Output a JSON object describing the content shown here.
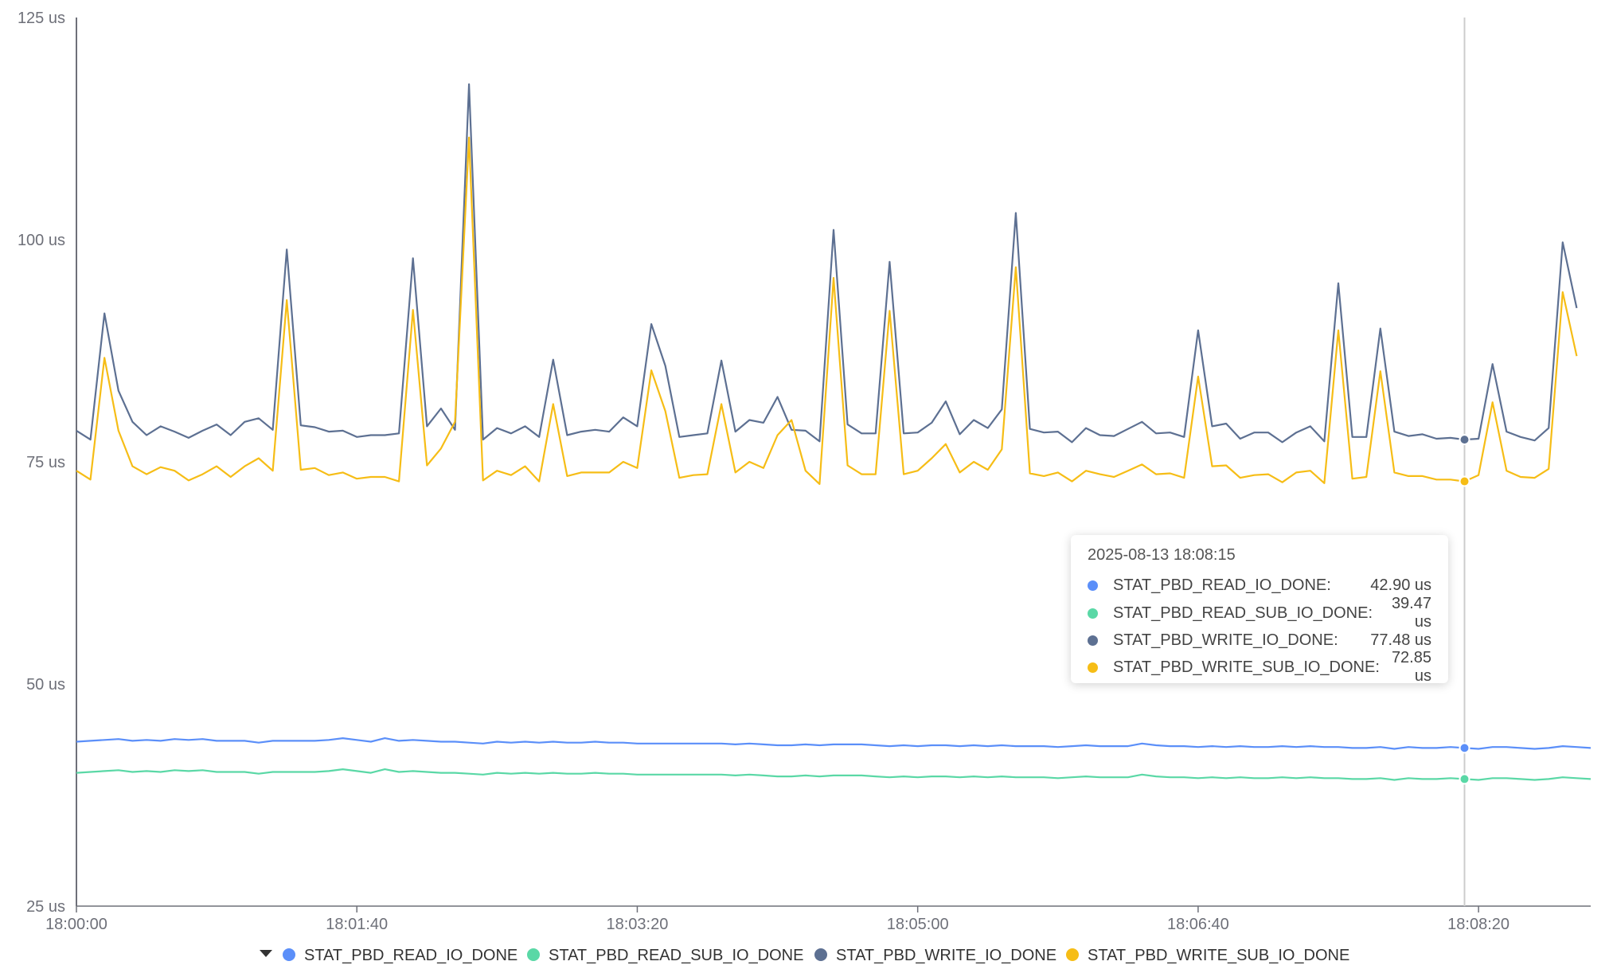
{
  "chart_data": {
    "type": "line",
    "y_unit": "us",
    "ylim": [
      25,
      125
    ],
    "y_ticks": [
      "25 us",
      "50 us",
      "75 us",
      "100 us",
      "125 us"
    ],
    "x_start": "18:00:00",
    "x_end": "18:09:00",
    "x_tick_labels": [
      "18:00:00",
      "18:01:40",
      "18:03:20",
      "18:05:00",
      "18:06:40",
      "18:08:20"
    ],
    "x_tick_seconds": [
      0,
      100,
      200,
      300,
      400,
      500
    ],
    "sample_interval_seconds": 5,
    "grid": false,
    "legend_position": "bottom",
    "series": [
      {
        "name": "STAT_PBD_READ_IO_DONE",
        "color": "#5b8ff9",
        "values": [
          43.5,
          43.6,
          43.7,
          43.8,
          43.6,
          43.7,
          43.6,
          43.8,
          43.7,
          43.8,
          43.6,
          43.6,
          43.6,
          43.4,
          43.6,
          43.6,
          43.6,
          43.6,
          43.7,
          43.9,
          43.7,
          43.5,
          43.9,
          43.6,
          43.7,
          43.6,
          43.5,
          43.5,
          43.4,
          43.3,
          43.5,
          43.4,
          43.5,
          43.4,
          43.5,
          43.4,
          43.4,
          43.5,
          43.4,
          43.4,
          43.3,
          43.3,
          43.3,
          43.3,
          43.3,
          43.3,
          43.3,
          43.2,
          43.3,
          43.2,
          43.1,
          43.1,
          43.2,
          43.1,
          43.2,
          43.2,
          43.2,
          43.1,
          43.0,
          43.1,
          43.0,
          43.1,
          43.1,
          43.0,
          43.1,
          43.0,
          43.1,
          43.0,
          43.0,
          43.0,
          42.9,
          43.0,
          43.1,
          43.0,
          43.0,
          43.0,
          43.3,
          43.1,
          43.0,
          43.0,
          42.9,
          43.0,
          42.9,
          43.0,
          42.9,
          42.9,
          43.0,
          42.9,
          43.0,
          42.9,
          42.9,
          42.8,
          42.8,
          42.9,
          42.7,
          42.9,
          42.8,
          42.8,
          42.9,
          42.8,
          42.7,
          42.9,
          42.9,
          42.8,
          42.7,
          42.8,
          43.0,
          42.9,
          42.8
        ]
      },
      {
        "name": "STAT_PBD_READ_SUB_IO_DONE",
        "color": "#5ad8a6",
        "values": [
          40.0,
          40.1,
          40.2,
          40.3,
          40.1,
          40.2,
          40.1,
          40.3,
          40.2,
          40.3,
          40.1,
          40.1,
          40.1,
          39.9,
          40.1,
          40.1,
          40.1,
          40.1,
          40.2,
          40.4,
          40.2,
          40.0,
          40.4,
          40.1,
          40.2,
          40.1,
          40.0,
          40.0,
          39.9,
          39.8,
          40.0,
          39.9,
          40.0,
          39.9,
          40.0,
          39.9,
          39.9,
          40.0,
          39.9,
          39.9,
          39.8,
          39.8,
          39.8,
          39.8,
          39.8,
          39.8,
          39.8,
          39.7,
          39.8,
          39.7,
          39.6,
          39.6,
          39.7,
          39.6,
          39.7,
          39.7,
          39.7,
          39.6,
          39.5,
          39.6,
          39.5,
          39.6,
          39.6,
          39.5,
          39.6,
          39.5,
          39.6,
          39.5,
          39.5,
          39.5,
          39.4,
          39.5,
          39.6,
          39.5,
          39.5,
          39.5,
          39.8,
          39.6,
          39.5,
          39.5,
          39.4,
          39.5,
          39.4,
          39.5,
          39.4,
          39.4,
          39.5,
          39.4,
          39.5,
          39.4,
          39.4,
          39.3,
          39.3,
          39.4,
          39.2,
          39.4,
          39.3,
          39.3,
          39.4,
          39.3,
          39.2,
          39.4,
          39.4,
          39.3,
          39.2,
          39.3,
          39.5,
          39.4,
          39.3
        ]
      },
      {
        "name": "STAT_PBD_WRITE_IO_DONE",
        "color": "#5d7092",
        "values": [
          78.5,
          77.5,
          91.7,
          83.0,
          79.5,
          78.0,
          79.0,
          78.4,
          77.7,
          78.5,
          79.2,
          78.0,
          79.5,
          79.9,
          78.6,
          98.9,
          79.1,
          78.9,
          78.4,
          78.5,
          77.8,
          78.0,
          78.0,
          78.2,
          97.9,
          79.0,
          81.0,
          78.6,
          117.5,
          77.5,
          78.8,
          78.2,
          79.0,
          77.8,
          86.5,
          78.0,
          78.4,
          78.6,
          78.4,
          80.0,
          79.0,
          90.5,
          85.8,
          77.8,
          78.0,
          78.2,
          86.4,
          78.4,
          79.7,
          79.4,
          82.3,
          78.6,
          78.5,
          77.3,
          101.1,
          79.2,
          78.2,
          78.2,
          97.5,
          78.2,
          78.3,
          79.4,
          81.8,
          78.1,
          79.7,
          78.8,
          80.9,
          103.0,
          78.7,
          78.3,
          78.4,
          77.2,
          78.8,
          78.0,
          77.9,
          78.7,
          79.5,
          78.2,
          78.3,
          77.8,
          89.8,
          79.0,
          79.3,
          77.6,
          78.3,
          78.3,
          77.2,
          78.3,
          79.0,
          77.3,
          95.1,
          77.8,
          77.8,
          90.0,
          78.4,
          77.9,
          78.1,
          77.6,
          77.7,
          77.5,
          77.6,
          86.0,
          78.4,
          77.8,
          77.4,
          78.8,
          99.7,
          92.3
        ]
      },
      {
        "name": "STAT_PBD_WRITE_SUB_IO_DONE",
        "color": "#f6bd16",
        "values": [
          74.0,
          73.0,
          86.7,
          78.5,
          74.5,
          73.6,
          74.4,
          74.0,
          72.9,
          73.6,
          74.5,
          73.3,
          74.5,
          75.4,
          74.0,
          93.2,
          74.1,
          74.3,
          73.5,
          73.8,
          73.1,
          73.3,
          73.3,
          72.8,
          92.1,
          74.6,
          76.5,
          79.5,
          111.5,
          72.9,
          74.0,
          73.5,
          74.5,
          72.8,
          81.5,
          73.4,
          73.8,
          73.8,
          73.8,
          75.0,
          74.3,
          85.3,
          80.7,
          73.2,
          73.5,
          73.6,
          81.5,
          73.8,
          75.0,
          74.3,
          78.0,
          79.7,
          74.0,
          72.5,
          95.7,
          74.6,
          73.6,
          73.6,
          92.0,
          73.6,
          74.0,
          75.4,
          77.0,
          73.8,
          75.0,
          74.1,
          76.4,
          96.9,
          73.7,
          73.4,
          73.8,
          72.8,
          74.0,
          73.6,
          73.3,
          74.0,
          74.7,
          73.6,
          73.7,
          73.2,
          84.6,
          74.5,
          74.6,
          73.2,
          73.5,
          73.6,
          72.7,
          73.8,
          74.0,
          72.6,
          89.8,
          73.1,
          73.3,
          85.2,
          73.8,
          73.4,
          73.4,
          73.0,
          73.0,
          72.8,
          73.5,
          81.7,
          74.0,
          73.3,
          73.2,
          74.2,
          94.1,
          86.9
        ]
      }
    ]
  },
  "legend": {
    "toggle_icon": "triangle-down-icon",
    "items": [
      {
        "label": "STAT_PBD_READ_IO_DONE",
        "color": "#5b8ff9"
      },
      {
        "label": "STAT_PBD_READ_SUB_IO_DONE",
        "color": "#5ad8a6"
      },
      {
        "label": "STAT_PBD_WRITE_IO_DONE",
        "color": "#5d7092"
      },
      {
        "label": "STAT_PBD_WRITE_SUB_IO_DONE",
        "color": "#f6bd16"
      }
    ]
  },
  "tooltip": {
    "timestamp": "2025-08-13 18:08:15",
    "hover_index": 99,
    "rows": [
      {
        "name": "STAT_PBD_READ_IO_DONE:",
        "value": "42.90 us",
        "color": "#5b8ff9"
      },
      {
        "name": "STAT_PBD_READ_SUB_IO_DONE:",
        "value": "39.47 us",
        "color": "#5ad8a6"
      },
      {
        "name": "STAT_PBD_WRITE_IO_DONE:",
        "value": "77.48 us",
        "color": "#5d7092"
      },
      {
        "name": "STAT_PBD_WRITE_SUB_IO_DONE:",
        "value": "72.85 us",
        "color": "#f6bd16"
      }
    ]
  }
}
